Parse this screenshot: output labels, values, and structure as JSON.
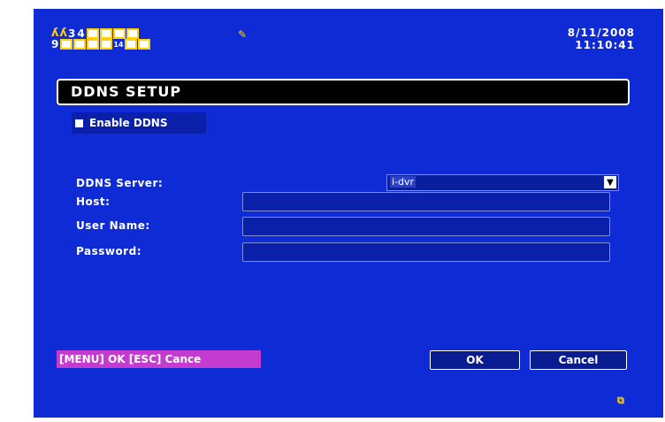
{
  "header": {
    "row1_channels": [
      "3",
      "4"
    ],
    "row2_channel_first": "9",
    "row2_channel_tiny": "14",
    "date": "8/11/2008",
    "time": "11:10:41"
  },
  "dialog": {
    "title": "DDNS SETUP",
    "enable_ddns_label": "Enable DDNS",
    "enable_ddns_checked": false,
    "ddns_server_label": "DDNS Server:",
    "ddns_server_value": "i-dvr",
    "host_label": "Host:",
    "host_value": "",
    "user_name_label": "User Name:",
    "user_name_value": "",
    "password_label": "Password:",
    "password_value": ""
  },
  "footer": {
    "hint": "[MENU] OK [ESC] Cance",
    "ok_label": "OK",
    "cancel_label": "Cancel"
  },
  "icons": {
    "person": "person-icon",
    "record": "record-icon",
    "dropdown": "dropdown-arrow-icon",
    "corner": "network-icon"
  },
  "colors": {
    "background": "#0e2bd6",
    "accent_yellow": "#ffd200",
    "hint_magenta": "#c43bd0"
  }
}
